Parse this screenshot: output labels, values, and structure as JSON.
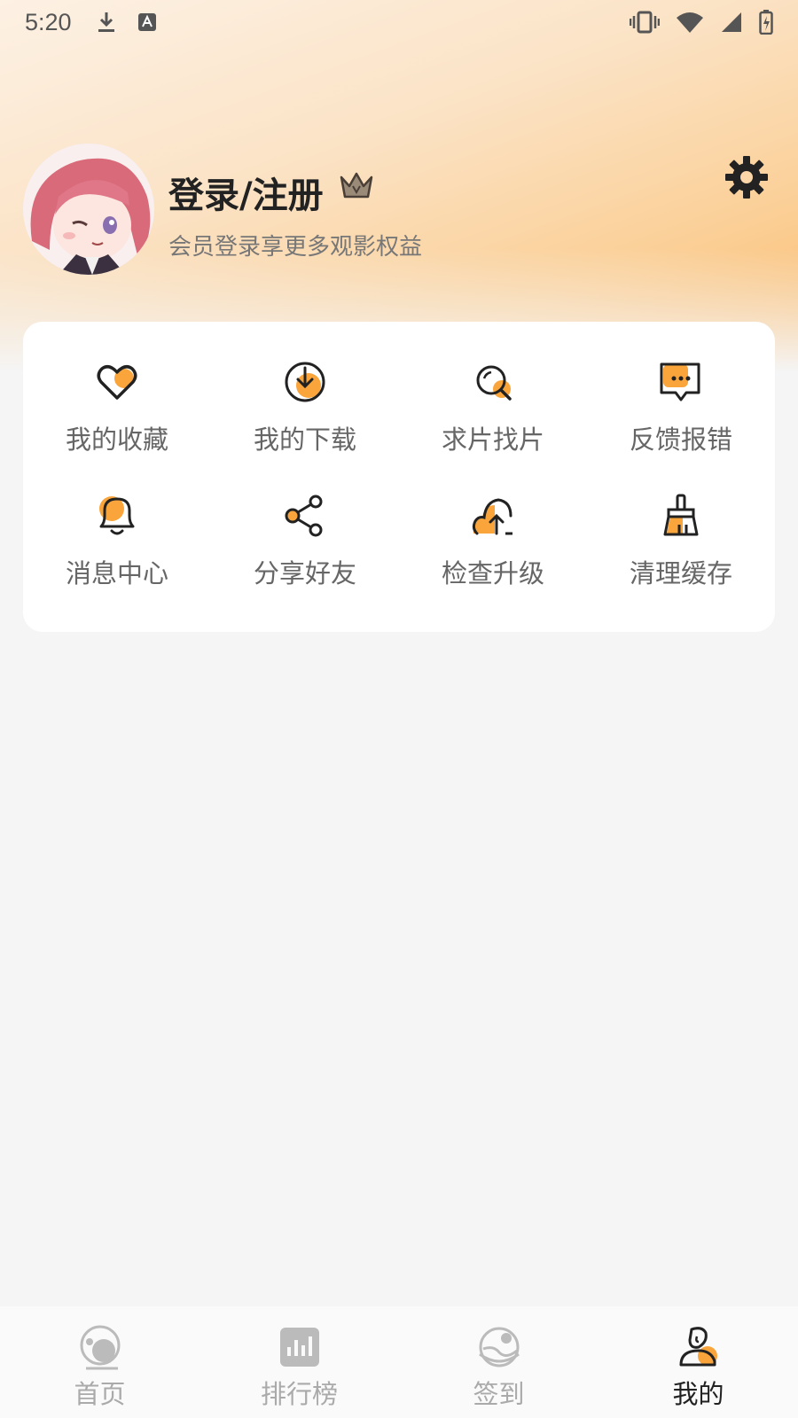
{
  "status_bar": {
    "time": "5:20"
  },
  "profile": {
    "title": "登录/注册",
    "subtitle": "会员登录享更多观影权益"
  },
  "menu": [
    {
      "label": "我的收藏",
      "icon": "heart-icon"
    },
    {
      "label": "我的下载",
      "icon": "download-icon"
    },
    {
      "label": "求片找片",
      "icon": "search-icon"
    },
    {
      "label": "反馈报错",
      "icon": "feedback-icon"
    },
    {
      "label": "消息中心",
      "icon": "bell-icon"
    },
    {
      "label": "分享好友",
      "icon": "share-icon"
    },
    {
      "label": "检查升级",
      "icon": "upgrade-icon"
    },
    {
      "label": "清理缓存",
      "icon": "brush-icon"
    }
  ],
  "bottom_nav": [
    {
      "label": "首页",
      "icon": "home-icon",
      "active": false
    },
    {
      "label": "排行榜",
      "icon": "chart-icon",
      "active": false
    },
    {
      "label": "签到",
      "icon": "checkin-icon",
      "active": false
    },
    {
      "label": "我的",
      "icon": "profile-icon",
      "active": true
    }
  ],
  "colors": {
    "accent": "#f9a53c",
    "dark": "#222222"
  }
}
